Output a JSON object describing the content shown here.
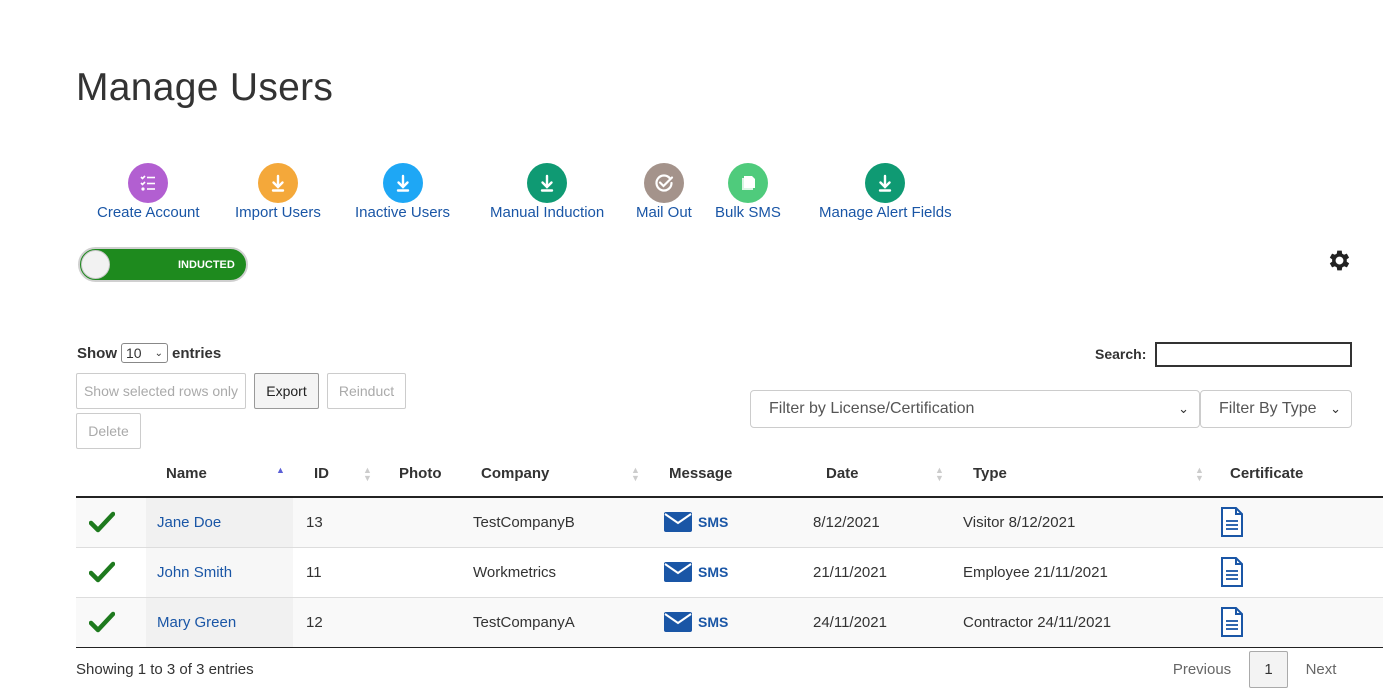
{
  "page": {
    "title": "Manage Users"
  },
  "toolbar": {
    "create_account": {
      "label": "Create Account",
      "icon": "checklist-icon",
      "color": "#b25fd1"
    },
    "import_users": {
      "label": "Import Users",
      "icon": "download-icon",
      "color": "#f4a83a"
    },
    "inactive_users": {
      "label": "Inactive Users",
      "icon": "download-icon",
      "color": "#1ea7f5"
    },
    "manual_induction": {
      "label": "Manual Induction",
      "icon": "download-icon",
      "color": "#0f9a73"
    },
    "mail_out": {
      "label": "Mail Out",
      "icon": "check-circle-icon",
      "color": "#a4938b"
    },
    "bulk_sms": {
      "label": "Bulk SMS",
      "icon": "documents-icon",
      "color": "#4fcb7c"
    },
    "manage_alert_fields": {
      "label": "Manage Alert Fields",
      "icon": "download-icon",
      "color": "#0f9a73"
    }
  },
  "toggle": {
    "label": "INDUCTED",
    "color": "#1e8a1e"
  },
  "controls": {
    "show_label": "Show",
    "entries_label": "entries",
    "page_size": "10",
    "search_label": "Search:",
    "search_value": "",
    "show_selected": "Show selected rows only",
    "export": "Export",
    "reinduct": "Reinduct",
    "delete": "Delete",
    "filter_license": "Filter by License/Certification",
    "filter_type": "Filter By Type"
  },
  "table": {
    "columns": [
      "Name",
      "ID",
      "Photo",
      "Company",
      "Message",
      "Date",
      "Type",
      "Certificate"
    ],
    "rows": [
      {
        "name": "Jane Doe",
        "id": "13",
        "company": "TestCompanyB",
        "message": "SMS",
        "date": "8/12/2021",
        "type": "Visitor 8/12/2021"
      },
      {
        "name": "John Smith",
        "id": "11",
        "company": "Workmetrics",
        "message": "SMS",
        "date": "21/11/2021",
        "type": "Employee 21/11/2021"
      },
      {
        "name": "Mary Green",
        "id": "12",
        "company": "TestCompanyA",
        "message": "SMS",
        "date": "24/11/2021",
        "type": "Contractor 24/11/2021"
      }
    ]
  },
  "footer": {
    "info": "Showing 1 to 3 of 3 entries",
    "previous": "Previous",
    "current_page": "1",
    "next": "Next"
  }
}
